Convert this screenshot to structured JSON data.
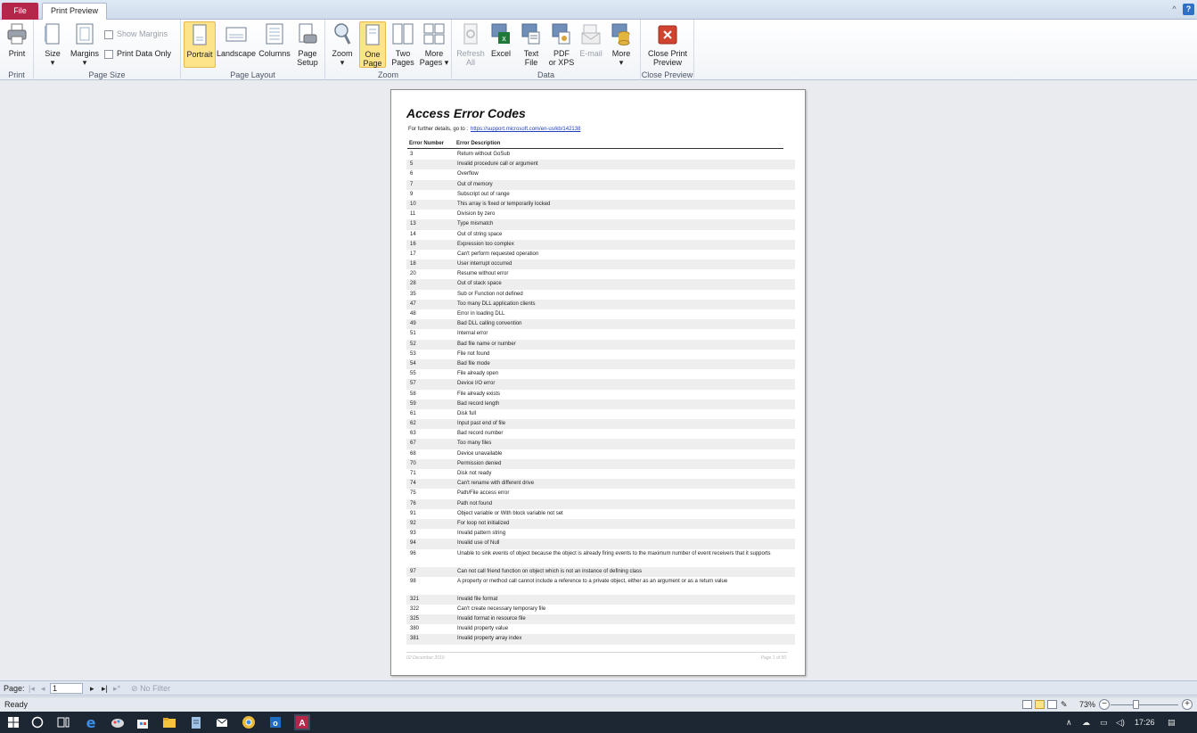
{
  "tabs": {
    "file": "File",
    "print_preview": "Print Preview"
  },
  "window_controls": {
    "collapse": "^",
    "help": "?"
  },
  "ribbon": {
    "print_group": {
      "print": "Print",
      "label": "Print"
    },
    "page_size_group": {
      "size": "Size",
      "margins": "Margins",
      "show_margins": "Show Margins",
      "print_data_only": "Print Data Only",
      "label": "Page Size"
    },
    "page_layout_group": {
      "portrait": "Portrait",
      "landscape": "Landscape",
      "columns": "Columns",
      "page_setup_1": "Page",
      "page_setup_2": "Setup",
      "label": "Page Layout"
    },
    "zoom_group": {
      "zoom": "Zoom",
      "one_page_1": "One",
      "one_page_2": "Page",
      "two_pages_1": "Two",
      "two_pages_2": "Pages",
      "more_pages_1": "More",
      "more_pages_2": "Pages",
      "label": "Zoom"
    },
    "data_group": {
      "refresh_1": "Refresh",
      "refresh_2": "All",
      "excel": "Excel",
      "text_1": "Text",
      "text_2": "File",
      "pdf_1": "PDF",
      "pdf_2": "or XPS",
      "email": "E-mail",
      "more": "More",
      "label": "Data"
    },
    "close_group": {
      "close_1": "Close Print",
      "close_2": "Preview",
      "label": "Close Preview"
    }
  },
  "report": {
    "title": "Access Error Codes",
    "details_prefix": "For further details, go to :",
    "details_link": "https://support.microsoft.com/en-us/kb/142138",
    "col_number": "Error Number",
    "col_description": "Error Description",
    "rows": [
      {
        "num": "3",
        "desc": "Return without GoSub"
      },
      {
        "num": "5",
        "desc": "Invalid procedure call or argument"
      },
      {
        "num": "6",
        "desc": "Overflow"
      },
      {
        "num": "7",
        "desc": "Out of memory"
      },
      {
        "num": "9",
        "desc": "Subscript out of range"
      },
      {
        "num": "10",
        "desc": "This array is fixed or temporarily locked"
      },
      {
        "num": "11",
        "desc": "Division by zero"
      },
      {
        "num": "13",
        "desc": "Type mismatch"
      },
      {
        "num": "14",
        "desc": "Out of string space"
      },
      {
        "num": "16",
        "desc": "Expression too complex"
      },
      {
        "num": "17",
        "desc": "Can't perform requested operation"
      },
      {
        "num": "18",
        "desc": "User interrupt occurred"
      },
      {
        "num": "20",
        "desc": "Resume without error"
      },
      {
        "num": "28",
        "desc": "Out of stack space"
      },
      {
        "num": "35",
        "desc": "Sub or Function not defined"
      },
      {
        "num": "47",
        "desc": "Too many DLL application clients"
      },
      {
        "num": "48",
        "desc": "Error in loading DLL"
      },
      {
        "num": "49",
        "desc": "Bad DLL calling convention"
      },
      {
        "num": "51",
        "desc": "Internal error"
      },
      {
        "num": "52",
        "desc": "Bad file name or number"
      },
      {
        "num": "53",
        "desc": "File not found"
      },
      {
        "num": "54",
        "desc": "Bad file mode"
      },
      {
        "num": "55",
        "desc": "File already open"
      },
      {
        "num": "57",
        "desc": "Device I/O error"
      },
      {
        "num": "58",
        "desc": "File already exists"
      },
      {
        "num": "59",
        "desc": "Bad record length"
      },
      {
        "num": "61",
        "desc": "Disk full"
      },
      {
        "num": "62",
        "desc": "Input past end of file"
      },
      {
        "num": "63",
        "desc": "Bad record number"
      },
      {
        "num": "67",
        "desc": "Too many files"
      },
      {
        "num": "68",
        "desc": "Device unavailable"
      },
      {
        "num": "70",
        "desc": "Permission denied"
      },
      {
        "num": "71",
        "desc": "Disk not ready"
      },
      {
        "num": "74",
        "desc": "Can't rename with different drive"
      },
      {
        "num": "75",
        "desc": "Path/File access error"
      },
      {
        "num": "76",
        "desc": "Path not found"
      },
      {
        "num": "91",
        "desc": "Object variable or With block variable not set"
      },
      {
        "num": "92",
        "desc": "For loop not initialized"
      },
      {
        "num": "93",
        "desc": "Invalid pattern string"
      },
      {
        "num": "94",
        "desc": "Invalid use of Null"
      },
      {
        "num": "96",
        "desc": "Unable to sink events of object because the object is already firing events to the maximum number of event receivers that it supports"
      },
      {
        "num": "97",
        "desc": "Can not call friend function on object which is not an instance of defining class"
      },
      {
        "num": "98",
        "desc": "A property or method call cannot include a reference to a private object, either as an argument or as a return value"
      },
      {
        "num": "321",
        "desc": "Invalid file format"
      },
      {
        "num": "322",
        "desc": "Can't create necessary temporary file"
      },
      {
        "num": "325",
        "desc": "Invalid format in resource file"
      },
      {
        "num": "380",
        "desc": "Invalid property value"
      },
      {
        "num": "381",
        "desc": "Invalid property array index"
      }
    ],
    "footer_date": "02 December 2019",
    "footer_page": "Page 1 of 50"
  },
  "navbar": {
    "page_label": "Page:",
    "page_value": "1",
    "no_filter": "No Filter"
  },
  "statusbar": {
    "status": "Ready",
    "zoom": "73%",
    "zoom_level_percent": 73
  },
  "taskbar": {
    "time": "17:26"
  },
  "colors": {
    "file_tab": "#b4264a",
    "active_button": "#fde48a",
    "taskbar": "#1c2733",
    "link": "#1f3fbf"
  }
}
